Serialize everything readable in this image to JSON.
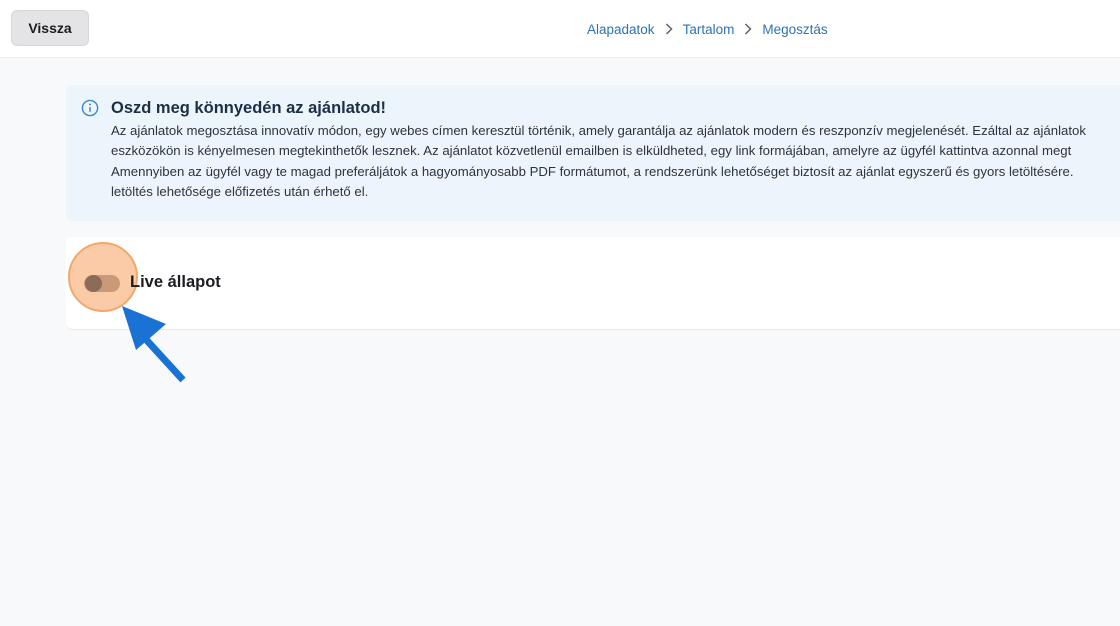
{
  "header": {
    "back_label": "Vissza",
    "breadcrumb": [
      "Alapadatok",
      "Tartalom",
      "Megosztás"
    ]
  },
  "info": {
    "icon": "info-icon",
    "title": "Oszd meg könnyedén az ajánlatod!",
    "lines": [
      "Az ajánlatok megosztása innovatív módon, egy webes címen keresztül történik, amely garantálja az ajánlatok modern és reszponzív megjelenését. Ezáltal az ajánlatok",
      "eszközökön is kényelmesen megtekinthetők lesznek. Az ajánlatot közvetlenül emailben is elküldheted, egy link formájában, amelyre az ügyfél kattintva azonnal megt",
      "Amennyiben az ügyfél vagy te magad preferáljátok a hagyományosabb PDF formátumot, a rendszerünk lehetőséget biztosít az ajánlat egyszerű és gyors letöltésére.",
      "letöltés lehetősége előfizetés után érhető el."
    ]
  },
  "live": {
    "label": "Live állapot",
    "enabled": false
  },
  "colors": {
    "accent": "#2d72b5",
    "info_bg": "#edf5fc",
    "highlight": "#fac196",
    "arrow": "#1a73d4"
  }
}
